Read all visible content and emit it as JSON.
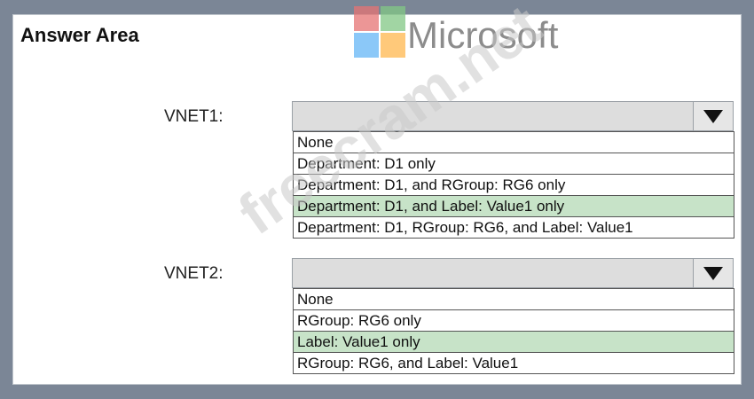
{
  "title": "Answer Area",
  "logo": {
    "text": "Microsoft",
    "colors": [
      "#e57373",
      "#81c784",
      "#64b5f6",
      "#ffb74d"
    ]
  },
  "watermark": "freecram.net",
  "vnet1": {
    "label": "VNET1:",
    "options": [
      "None",
      "Department: D1 only",
      "Department: D1, and RGroup: RG6 only",
      "Department: D1, and Label: Value1 only",
      "Department: D1, RGroup: RG6, and Label: Value1"
    ],
    "selected_index": 3
  },
  "vnet2": {
    "label": "VNET2:",
    "options": [
      "None",
      "RGroup: RG6 only",
      "Label: Value1 only",
      "RGroup: RG6, and Label: Value1"
    ],
    "selected_index": 2
  }
}
